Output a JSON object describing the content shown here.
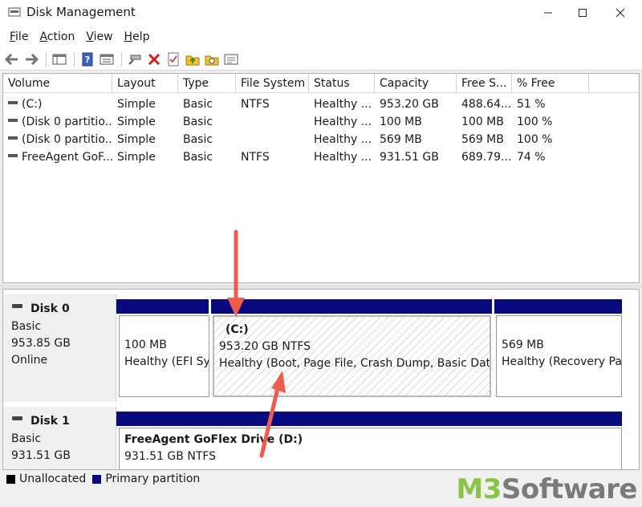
{
  "window": {
    "title": "Disk Management",
    "controls": {
      "minimize": "—",
      "maximize": "☐",
      "close": "✕"
    }
  },
  "menu": [
    {
      "accel": "F",
      "rest": "ile"
    },
    {
      "accel": "A",
      "rest": "ction"
    },
    {
      "accel": "V",
      "rest": "iew"
    },
    {
      "accel": "H",
      "rest": "elp"
    }
  ],
  "toolbar": {
    "back_icon": "←",
    "forward_icon": "→",
    "delete_icon": "✕"
  },
  "volume_table": {
    "columns": [
      "Volume",
      "Layout",
      "Type",
      "File System",
      "Status",
      "Capacity",
      "Free S...",
      "% Free"
    ],
    "rows": [
      [
        "(C:)",
        "Simple",
        "Basic",
        "NTFS",
        "Healthy ...",
        "953.20 GB",
        "488.64...",
        "51 %"
      ],
      [
        "(Disk 0 partitio...",
        "Simple",
        "Basic",
        "",
        "Healthy ...",
        "100 MB",
        "100 MB",
        "100 %"
      ],
      [
        "(Disk 0 partitio...",
        "Simple",
        "Basic",
        "",
        "Healthy ...",
        "569 MB",
        "569 MB",
        "100 %"
      ],
      [
        "FreeAgent GoF...",
        "Simple",
        "Basic",
        "NTFS",
        "Healthy ...",
        "931.51 GB",
        "689.79...",
        "74 %"
      ]
    ]
  },
  "disks": [
    {
      "name": "Disk 0",
      "type": "Basic",
      "size": "953.85 GB",
      "status": "Online",
      "partitions": [
        {
          "title": "",
          "line1": "100 MB",
          "line2": "Healthy (EFI Sy"
        },
        {
          "title": "(C:)",
          "line1": "953.20 GB NTFS",
          "line2": "Healthy (Boot, Page File, Crash Dump, Basic Dat"
        },
        {
          "title": "",
          "line1": "569 MB",
          "line2": "Healthy (Recovery Pa"
        }
      ]
    },
    {
      "name": "Disk 1",
      "type": "Basic",
      "size": "931.51 GB",
      "partitions": [
        {
          "title": "FreeAgent GoFlex Drive (D:)",
          "line1": "931.51 GB NTFS"
        }
      ]
    }
  ],
  "legend": {
    "unallocated": "Unallocated",
    "primary": "Primary partition",
    "unallocated_color": "#000000",
    "primary_color": "#0a0a80"
  },
  "watermark": {
    "m3": "M3",
    "software": "Software",
    "m3_color": "#8bc34a",
    "software_color": "#7a7a7a"
  },
  "annotation_color": "#ef5b4c"
}
